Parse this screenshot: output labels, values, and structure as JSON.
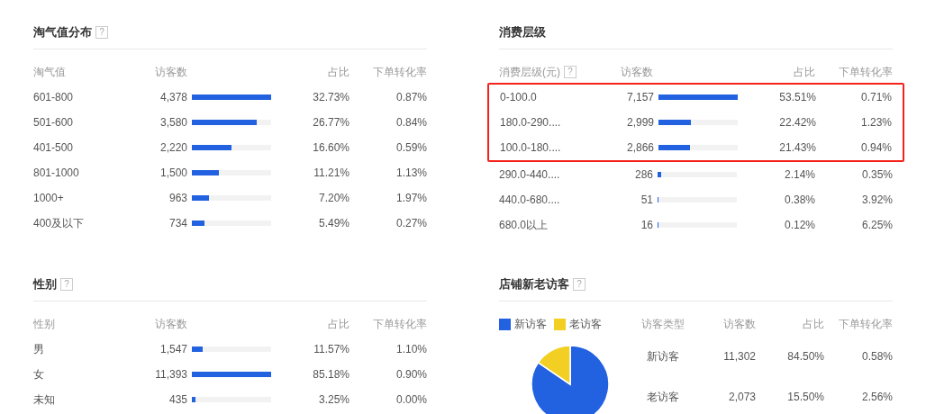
{
  "sections": [
    {
      "title": "淘气值分布",
      "help": "?",
      "columns": [
        "淘气值",
        "访客数",
        "占比",
        "下单转化率"
      ],
      "rows": [
        {
          "label": "601-800",
          "visitors": "4,378",
          "level": 1,
          "share": "32.73%",
          "rate": "0.87%"
        },
        {
          "label": "501-600",
          "visitors": "3,580",
          "level": 0.82,
          "share": "26.77%",
          "rate": "0.84%"
        },
        {
          "label": "401-500",
          "visitors": "2,220",
          "level": 0.5,
          "share": "16.60%",
          "rate": "0.59%"
        },
        {
          "label": "801-1000",
          "visitors": "1,500",
          "level": 0.34,
          "share": "11.21%",
          "rate": "1.13%"
        },
        {
          "label": "1000+",
          "visitors": "963",
          "level": 0.22,
          "share": "7.20%",
          "rate": "1.97%"
        },
        {
          "label": "400及以下",
          "visitors": "734",
          "level": 0.16,
          "share": "5.49%",
          "rate": "0.27%"
        }
      ]
    },
    {
      "title": "消费层级",
      "column_help": "?",
      "columns": [
        "消费层级(元)",
        "访客数",
        "占比",
        "下单转化率"
      ],
      "rows": [
        {
          "label": "0-100.0",
          "visitors": "7,157",
          "level": 1,
          "share": "53.51%",
          "rate": "0.71%",
          "highlighted": true
        },
        {
          "label": "180.0-290....",
          "visitors": "2,999",
          "level": 0.41,
          "share": "22.42%",
          "rate": "1.23%",
          "highlighted": true
        },
        {
          "label": "100.0-180....",
          "visitors": "2,866",
          "level": 0.4,
          "share": "21.43%",
          "rate": "0.94%",
          "highlighted": true
        },
        {
          "label": "290.0-440....",
          "visitors": "286",
          "level": 0.04,
          "share": "2.14%",
          "rate": "0.35%",
          "highlighted": false
        },
        {
          "label": "440.0-680....",
          "visitors": "51",
          "level": 0.007,
          "share": "0.38%",
          "rate": "3.92%",
          "highlighted": false
        },
        {
          "label": "680.0以上",
          "visitors": "16",
          "level": 0.002,
          "share": "0.12%",
          "rate": "6.25%",
          "highlighted": false
        }
      ]
    },
    {
      "title": "性别",
      "help": "?",
      "columns": [
        "性别",
        "访客数",
        "占比",
        "下单转化率"
      ],
      "rows": [
        {
          "label": "男",
          "visitors": "1,547",
          "level": 0.14,
          "share": "11.57%",
          "rate": "1.10%"
        },
        {
          "label": "女",
          "visitors": "11,393",
          "level": 1,
          "share": "85.18%",
          "rate": "0.90%"
        },
        {
          "label": "未知",
          "visitors": "435",
          "level": 0.04,
          "share": "3.25%",
          "rate": "0.00%"
        }
      ]
    }
  ],
  "visitors": {
    "title": "店铺新老访客",
    "help": "?",
    "legend": [
      {
        "color": "#2262e0"
      },
      {
        "color": "#f2cf22"
      }
    ],
    "columns": [
      "访客类型",
      "访客数",
      "占比",
      "下单转化率"
    ],
    "rows": [
      {
        "type": "新访客",
        "visitors": "11,302",
        "share": "84.50%",
        "rate": "0.58%"
      },
      {
        "type": "老访客",
        "visitors": "2,073",
        "share": "15.50%",
        "rate": "2.56%"
      }
    ],
    "chart_data": {
      "type": "pie",
      "categories": [
        "新访客",
        "老访客"
      ],
      "values": [
        84.5,
        15.5
      ]
    }
  }
}
